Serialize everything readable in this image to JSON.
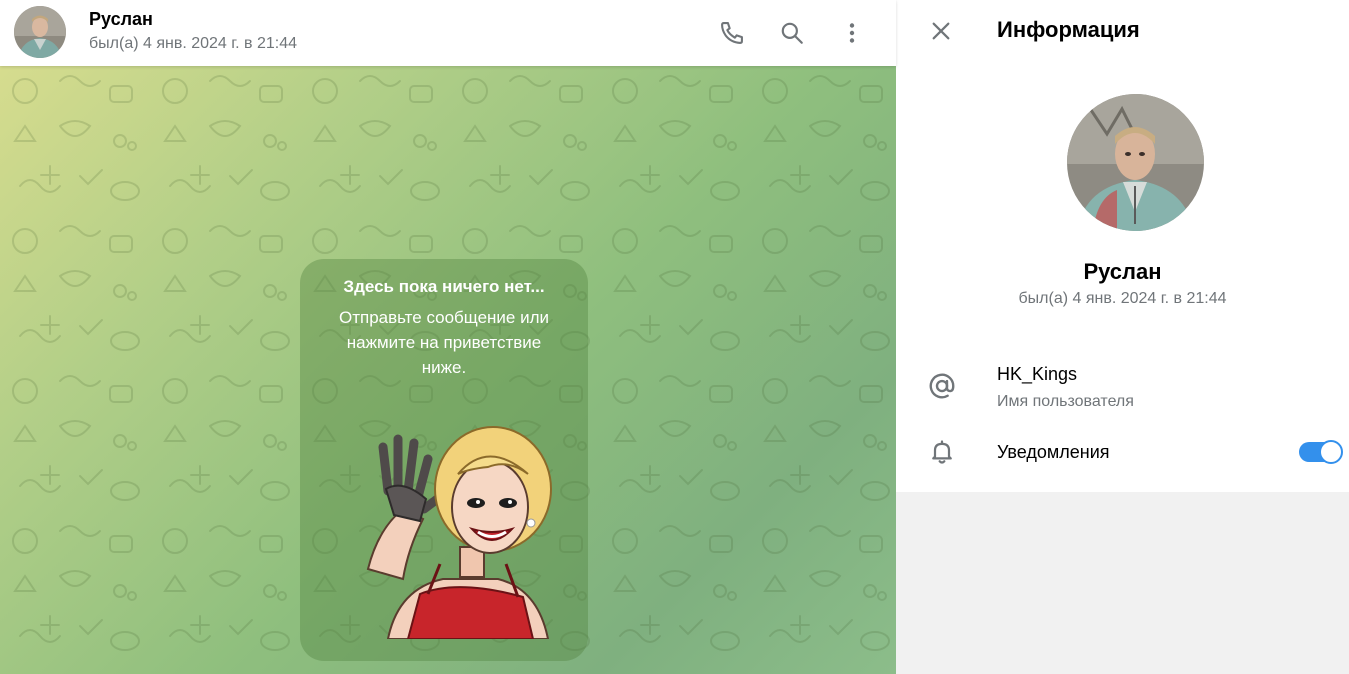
{
  "chat": {
    "peer_name": "Руслан",
    "peer_status": "был(а) 4 янв. 2024 г. в 21:44",
    "header_icons": [
      "phone-icon",
      "search-icon",
      "more-vertical-icon"
    ],
    "empty_state": {
      "title": "Здесь пока ничего нет...",
      "subtitle": "Отправьте сообщение или нажмите на приветствие ниже."
    }
  },
  "info_panel": {
    "title": "Информация",
    "name": "Руслан",
    "status": "был(а) 4 янв. 2024 г. в 21:44",
    "username": {
      "value": "HK_Kings",
      "label": "Имя пользователя"
    },
    "notifications": {
      "label": "Уведомления",
      "enabled": true
    }
  },
  "colors": {
    "accent": "#3390ec",
    "secondary_text": "#707579",
    "panel_bg": "#f1f1f1"
  }
}
